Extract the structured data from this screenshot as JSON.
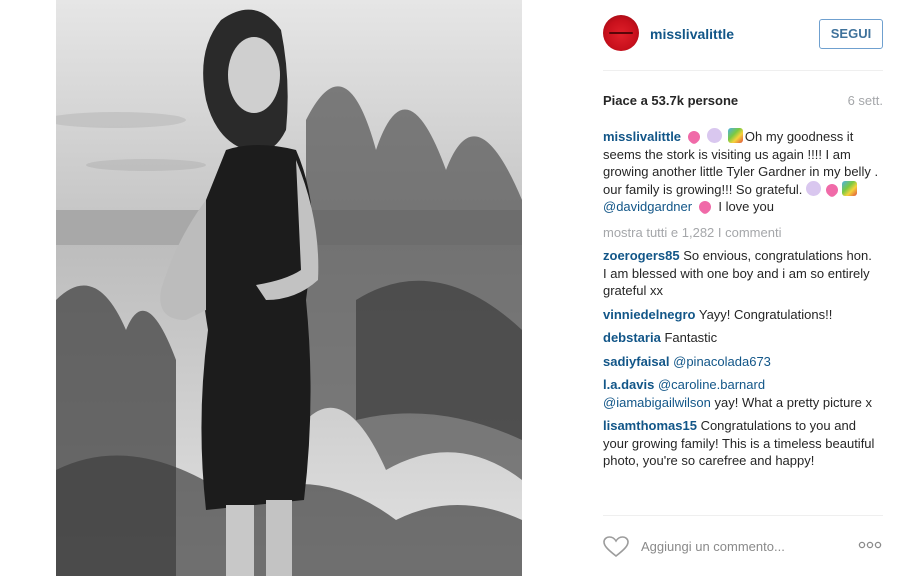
{
  "post": {
    "image_alt": "Black and white photo of a smiling woman in a slip dress standing among dune grass by the sea"
  },
  "header": {
    "username": "missliva little",
    "follow_label": "SEGUI"
  },
  "stats": {
    "likes": "Piace a 53.7k persone",
    "age": "6 sett."
  },
  "caption": {
    "username": "misslivalittle",
    "text_1": "Oh my goodness it seems the stork is visiting us again !!!! I am growing another little Tyler Gardner in my belly . our family is growing!!! So grateful.",
    "mention": "@davidgardner",
    "text_2": "I love you"
  },
  "show_all_comments": "mostra tutti e 1,282 I commenti",
  "comments": [
    {
      "username": "zoerogers85",
      "text": "So envious, congratulations hon. I am blessed with one boy and i am so entirely grateful xx"
    },
    {
      "username": "vinniedelnegro",
      "text": "Yayy! Congratulations!!"
    },
    {
      "username": "debstaria",
      "text": "Fantastic"
    },
    {
      "username": "sadiyfaisal",
      "mention": "@pinacolada673",
      "text": ""
    },
    {
      "username": "l.a.davis",
      "mention": "@caroline.barnard",
      "mention2": "@iamabigailwilson",
      "text": "yay! What a pretty picture x"
    },
    {
      "username": "lisamthomas15",
      "text": "Congratulations to you and your growing family! This is a timeless beautiful photo, you're so carefree and happy!"
    }
  ],
  "footer": {
    "comment_placeholder": "Aggiungi un commento..."
  },
  "icons": {
    "like": "heart-outline-icon",
    "more": "ellipsis-icon"
  },
  "colors": {
    "username": "#125688",
    "follow_border": "#6fa0cf",
    "muted": "#a5a7aa"
  }
}
